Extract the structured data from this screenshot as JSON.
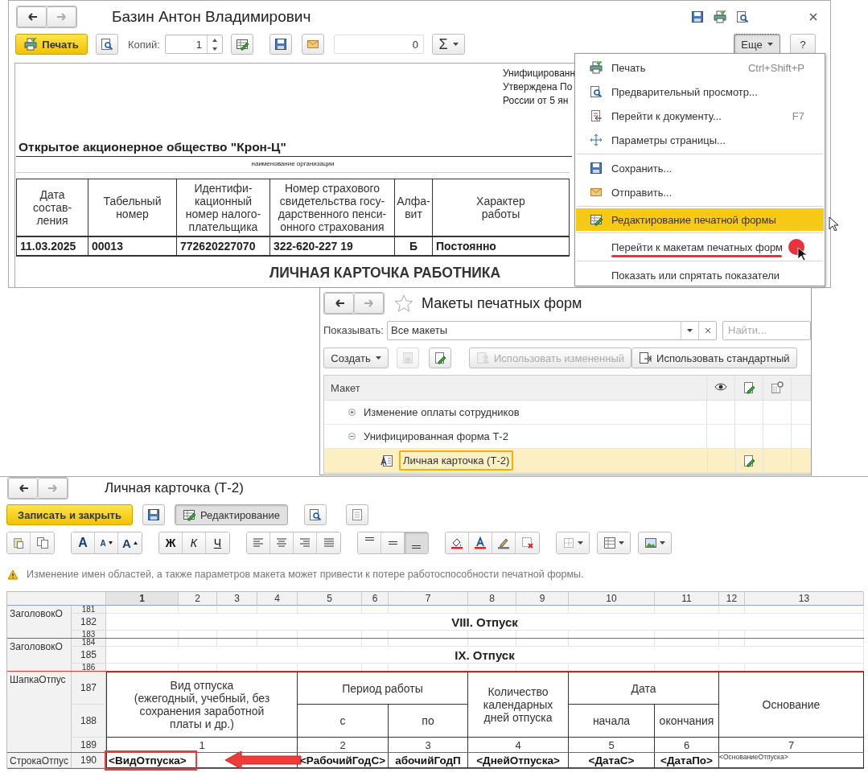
{
  "doc_window": {
    "title": "Базин Антон Владимирович",
    "toolbar": {
      "print": "Печать",
      "copies_label": "Копий:",
      "copies": "1",
      "amount": "0",
      "sum": "Σ",
      "more": {
        "label": "Еще",
        "pressed": true
      },
      "help": "?"
    },
    "document": {
      "header_note": [
        "Унифицированн",
        "Утверждена По",
        "России от 5 ян"
      ],
      "organization": "Открытое акционерное общество \"Крон-Ц\"",
      "organization_caption": "наименование организации",
      "columns": [
        "Дата\nсостав-\nления",
        "Табельный\nномер",
        "Идентифи-\nкационный\nномер налого-\nплательщика",
        "Номер страхового\nсвидетельства госу-\nдарственного пенси-\nонного страхования",
        "Алфа-\nвит",
        "Характер\nработы"
      ],
      "row": [
        "11.03.2025",
        "00013",
        "772620227070",
        "322-620-227 19",
        "Б",
        "Постоянно"
      ],
      "title": "ЛИЧНАЯ КАРТОЧКА РАБОТНИКА"
    }
  },
  "menu": {
    "groups": [
      [
        {
          "kind": "print",
          "label": "Печать",
          "shortcut": "Ctrl+Shift+P",
          "selected": false,
          "marked": false
        },
        {
          "kind": "preview",
          "label": "Предварительный просмотр...",
          "selected": false,
          "marked": false
        },
        {
          "kind": "goto",
          "label": "Перейти к документу...",
          "shortcut": "F7",
          "selected": false,
          "marked": false
        },
        {
          "kind": "page-setup",
          "label": "Параметры страницы...",
          "selected": false,
          "marked": false
        }
      ],
      [
        {
          "kind": "save",
          "label": "Сохранить...",
          "selected": false,
          "marked": false
        },
        {
          "kind": "send",
          "label": "Отправить...",
          "selected": false,
          "marked": false
        }
      ],
      [
        {
          "kind": "edit",
          "label": "Редактирование печатной формы",
          "selected": true,
          "marked": false
        }
      ],
      [
        {
          "kind": "plain",
          "label": "Перейти к макетам печатных форм",
          "selected": false,
          "marked": true
        }
      ],
      [
        {
          "kind": "plain",
          "label": "Показать или спрятать показатели",
          "selected": false,
          "marked": false
        }
      ]
    ]
  },
  "templates_window": {
    "title": "Макеты печатных форм",
    "favorite": false,
    "filter_label": "Показывать:",
    "filter_value": "Все макеты",
    "search_placeholder": "Найти...",
    "create": "Создать",
    "use_changed": {
      "label": "Использовать измененный",
      "disabled": true
    },
    "use_standard": {
      "label": "Использовать стандартный",
      "disabled": false
    },
    "column": "Макет",
    "tree": [
      {
        "label": "Изменение оплаты сотрудников",
        "expanded": false,
        "selected": false,
        "edited": false
      },
      {
        "label": "Унифицированная форма Т-2",
        "expanded": true,
        "selected": false,
        "edited": false,
        "children": [
          {
            "label": "Личная карточка (Т-2)",
            "selected": true,
            "edited": true
          }
        ]
      }
    ]
  },
  "editor_window": {
    "title": "Личная карточка (Т-2)",
    "save_close": "Записать и закрыть",
    "edit_mode": {
      "label": "Редактирование",
      "pressed": true
    },
    "format_groups": [
      [
        {
          "kind": "paste",
          "pressed": false
        },
        {
          "kind": "copy",
          "pressed": false
        }
      ],
      [
        {
          "kind": "font",
          "label": "A",
          "pressed": false
        },
        {
          "kind": "font-smaller",
          "label": "A",
          "pressed": false
        },
        {
          "kind": "font-larger",
          "label": "A",
          "pressed": false
        }
      ],
      [
        {
          "kind": "bold",
          "label": "Ж",
          "pressed": false
        },
        {
          "kind": "italic",
          "label": "К",
          "pressed": false
        },
        {
          "kind": "underline",
          "label": "Ч",
          "pressed": false
        }
      ],
      [
        {
          "kind": "align-left",
          "pressed": false
        },
        {
          "kind": "align-center",
          "pressed": false
        },
        {
          "kind": "align-right",
          "pressed": false
        },
        {
          "kind": "align-justify",
          "pressed": false
        }
      ],
      [
        {
          "kind": "valign-top",
          "pressed": false
        },
        {
          "kind": "valign-middle",
          "pressed": false
        },
        {
          "kind": "valign-bottom",
          "pressed": true
        }
      ],
      [
        {
          "kind": "fill-color",
          "pressed": false
        },
        {
          "kind": "text-color",
          "pressed": false
        },
        {
          "kind": "border-color",
          "pressed": false
        },
        {
          "kind": "clear-format",
          "pressed": false
        }
      ],
      [
        {
          "kind": "borders",
          "pressed": false
        }
      ],
      [
        {
          "kind": "table",
          "pressed": false
        }
      ],
      [
        {
          "kind": "picture",
          "pressed": false
        }
      ]
    ],
    "warning": "Изменение имен областей, а также параметров макета может привести к потере работоспособности печатной формы.",
    "sheet": {
      "columns": [
        {
          "label": "1",
          "selected": true
        },
        {
          "label": "2",
          "selected": false
        },
        {
          "label": "3",
          "selected": false
        },
        {
          "label": "4",
          "selected": false
        },
        {
          "label": "5",
          "selected": false
        },
        {
          "label": "6",
          "selected": false
        },
        {
          "label": "7",
          "selected": false
        },
        {
          "label": "8",
          "selected": false
        },
        {
          "label": "9",
          "selected": false
        },
        {
          "label": "10",
          "selected": false
        },
        {
          "label": "11",
          "selected": false
        },
        {
          "label": "12",
          "selected": false
        },
        {
          "label": "13",
          "selected": false
        }
      ],
      "rows": [
        {
          "number": "181",
          "kind": "thin"
        },
        {
          "number": "182",
          "kind": "title"
        },
        {
          "number": "183",
          "kind": "thin"
        },
        {
          "number": "184",
          "kind": "thin"
        },
        {
          "number": "185",
          "kind": "title"
        },
        {
          "number": "186",
          "kind": "thin"
        },
        {
          "number": "187",
          "kind": "header"
        },
        {
          "number": "188",
          "kind": "header"
        },
        {
          "number": "189",
          "kind": "index"
        },
        {
          "number": "190",
          "kind": "data"
        }
      ],
      "areas": [
        {
          "name": "ЗаголовокО"
        },
        {
          "name": "ЗаголовокО"
        },
        {
          "name": "ШапкаОтпус"
        },
        {
          "name": "СтрокаОтпус"
        }
      ],
      "cells": [
        {
          "text": "VIII. Отпуск",
          "highlighted": false
        },
        {
          "text": "IX. Отпуск",
          "highlighted": false
        },
        {
          "text": "Вид отпуска\n(ежегодный, учебный, без\nсохранения заработной\nплаты и др.)",
          "highlighted": false
        },
        {
          "text": "Период работы",
          "highlighted": false
        },
        {
          "text": "Количество\nкалендарных\nдней отпуска",
          "highlighted": false
        },
        {
          "text": "Дата",
          "highlighted": false
        },
        {
          "text": "Основание",
          "highlighted": false
        },
        {
          "text": "с",
          "highlighted": false
        },
        {
          "text": "по",
          "highlighted": false
        },
        {
          "text": "начала",
          "highlighted": false
        },
        {
          "text": "окончания",
          "highlighted": false
        },
        {
          "text": "1",
          "highlighted": false
        },
        {
          "text": "2",
          "highlighted": false
        },
        {
          "text": "3",
          "highlighted": false
        },
        {
          "text": "4",
          "highlighted": false
        },
        {
          "text": "5",
          "highlighted": false
        },
        {
          "text": "6",
          "highlighted": false
        },
        {
          "text": "7",
          "highlighted": false
        },
        {
          "text": "<ВидОтпуска>",
          "highlighted": true
        },
        {
          "text": "<РабочийГодС>",
          "highlighted": false
        },
        {
          "text": "абочийГодП",
          "highlighted": false
        },
        {
          "text": "<ДнейОтпуска>",
          "highlighted": false
        },
        {
          "text": "<ДатаС>",
          "highlighted": false
        },
        {
          "text": "<ДатаПо>",
          "highlighted": false
        },
        {
          "text": "<ОснованиеОтпуска>",
          "highlighted": false
        }
      ]
    }
  }
}
